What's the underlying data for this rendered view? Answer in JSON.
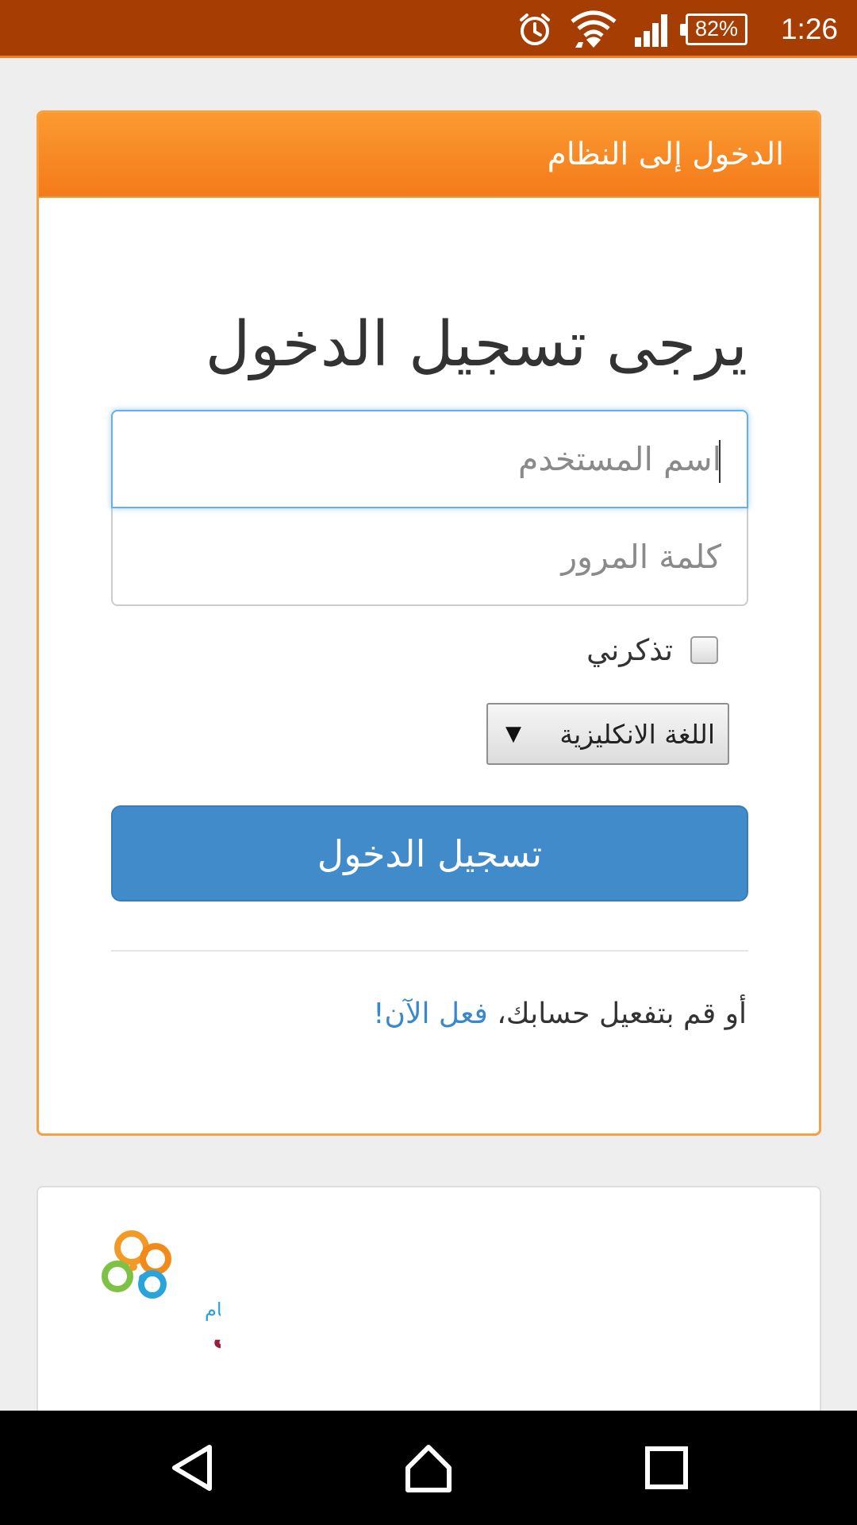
{
  "status_bar": {
    "time": "1:26",
    "battery": "82%",
    "icons": [
      "alarm-icon",
      "wifi-icon",
      "signal-icon",
      "battery-icon"
    ]
  },
  "login": {
    "header_title": "الدخول إلى النظام",
    "form_title": "يرجى تسجيل الدخول",
    "username_placeholder": "اسم المستخدم",
    "password_placeholder": "كلمة المرور",
    "remember_label": "تذكرني",
    "language_selected": "اللغة الانكليزية",
    "login_button": "تسجيل الدخول",
    "activate_text": "أو قم بتفعيل حسابك، ",
    "activate_link": "فعل الآن!"
  },
  "logo": {
    "small_text": "نظام",
    "big_text": "مدرستي"
  },
  "colors": {
    "status_bar": "#a63e03",
    "header": "#f47b1a",
    "primary_button": "#428bca",
    "link": "#3a87c9"
  },
  "nav_bar": {
    "icons": [
      "back-icon",
      "home-icon",
      "recent-apps-icon"
    ]
  }
}
